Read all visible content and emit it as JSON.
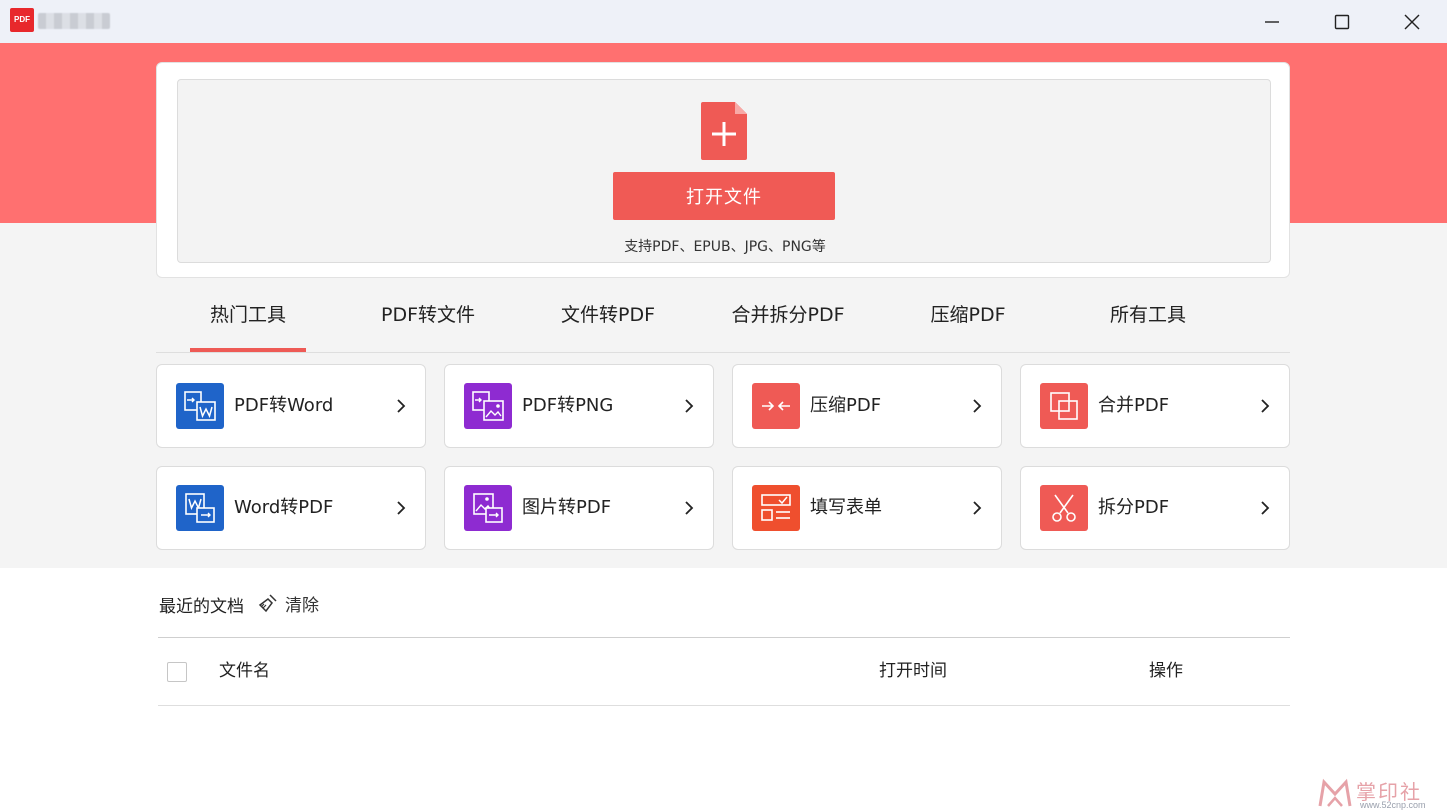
{
  "window": {
    "logo_text": "PDF",
    "minimize_icon": "minimize-icon",
    "maximize_icon": "maximize-icon",
    "close_icon": "close-icon"
  },
  "upload": {
    "file_icon": "file-plus-icon",
    "open_label": "打开文件",
    "support_text": "支持PDF、EPUB、JPG、PNG等"
  },
  "tabs": [
    {
      "label": "热门工具",
      "active": true
    },
    {
      "label": "PDF转文件",
      "active": false
    },
    {
      "label": "文件转PDF",
      "active": false
    },
    {
      "label": "合并拆分PDF",
      "active": false
    },
    {
      "label": "压缩PDF",
      "active": false
    },
    {
      "label": "所有工具",
      "active": false
    }
  ],
  "tools": [
    {
      "label": "PDF转Word",
      "icon": "pdf-to-word-icon",
      "color": "#1f64c9"
    },
    {
      "label": "PDF转PNG",
      "icon": "pdf-to-png-icon",
      "color": "#8e2bd1"
    },
    {
      "label": "压缩PDF",
      "icon": "compress-icon",
      "color": "#ef5a55"
    },
    {
      "label": "合并PDF",
      "icon": "merge-icon",
      "color": "#ef5a55"
    },
    {
      "label": "Word转PDF",
      "icon": "word-to-pdf-icon",
      "color": "#1f64c9"
    },
    {
      "label": "图片转PDF",
      "icon": "image-to-pdf-icon",
      "color": "#8e2bd1"
    },
    {
      "label": "填写表单",
      "icon": "form-fill-icon",
      "color": "#ef4f2e"
    },
    {
      "label": "拆分PDF",
      "icon": "split-icon",
      "color": "#ef5a55"
    }
  ],
  "recent": {
    "title": "最近的文档",
    "clear_label": "清除",
    "columns": {
      "filename": "文件名",
      "open_time": "打开时间",
      "action": "操作"
    }
  },
  "watermark": {
    "text": "掌印社区",
    "url": "www.52cnp.com"
  }
}
